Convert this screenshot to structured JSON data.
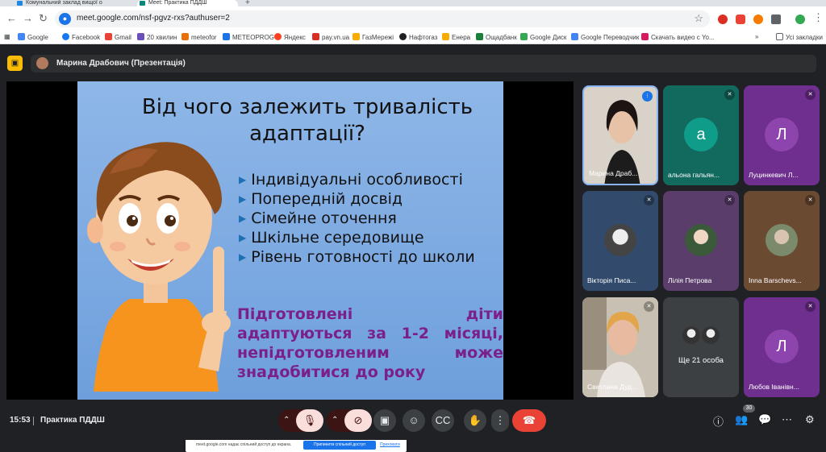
{
  "browser": {
    "tabs": [
      {
        "label": "Комунальний заклад вищої о"
      },
      {
        "label": "Meet: Практика ПДДШ"
      }
    ],
    "url": "meet.google.com/nsf-pgvz-rxs?authuser=2",
    "bookmarks": [
      {
        "label": "Google",
        "color": "#4285f4"
      },
      {
        "label": "Facebook",
        "color": "#1877f2"
      },
      {
        "label": "Gmail",
        "color": "#ea4335"
      },
      {
        "label": "20 хвилин",
        "color": "#6b4fbb"
      },
      {
        "label": "meteofor",
        "color": "#e8710a"
      },
      {
        "label": "METEOPROG",
        "color": "#1a73e8"
      },
      {
        "label": "Яндекс",
        "color": "#fc3f1d"
      },
      {
        "label": "pay.vn.ua",
        "color": "#d93025"
      },
      {
        "label": "ГазМережі",
        "color": "#f9ab00"
      },
      {
        "label": "Нафтогаз",
        "color": "#202124"
      },
      {
        "label": "Енера",
        "color": "#f9ab00"
      },
      {
        "label": "Ощадбанк",
        "color": "#188038"
      },
      {
        "label": "Google Диск",
        "color": "#34a853"
      },
      {
        "label": "Google Переводчик",
        "color": "#4285f4"
      },
      {
        "label": "Скачать видео с Yo...",
        "color": "#d81b60"
      }
    ],
    "all_bookmarks": "Усі закладки"
  },
  "meet": {
    "presenter_label": "Марина Драбович (Презентація)",
    "slide": {
      "title": "Від чого залежить тривалість адаптації?",
      "bullets": [
        "Індивідуальні особливості",
        "Попередній досвід",
        "Сімейне оточення",
        "Шкільне середовище",
        "Рівень готовності до школи"
      ],
      "note": "Підготовлені діти адаптуються за 1-2 місяці, непідготовленим може знадобитися до року"
    },
    "share_bar": {
      "message": "meet.google.com надає спільний доступ до екрана.",
      "stop_label": "Припинити спільний доступ",
      "hide_label": "Приховати"
    },
    "participants": [
      {
        "name": "Марина Драб...",
        "type": "video",
        "bg": "#c9c2b8"
      },
      {
        "name": "альона гальян...",
        "type": "letter",
        "letter": "а",
        "bg": "#12695e",
        "circle": "#0f9d8a"
      },
      {
        "name": "Луцинкевич Л...",
        "type": "letter",
        "letter": "Л",
        "bg": "#6f2f8e",
        "circle": "#8e44ad"
      },
      {
        "name": "Вікторія Писа...",
        "type": "photo",
        "bg": "#324a6b"
      },
      {
        "name": "Лілія Петрова",
        "type": "photo",
        "bg": "#5a3d6b"
      },
      {
        "name": "Inna Barschevs...",
        "type": "photo",
        "bg": "#6b4a32"
      },
      {
        "name": "Светлана Дуд...",
        "type": "video",
        "bg": "#b9b3a8"
      },
      {
        "name": "Ще 21 особа",
        "type": "more",
        "bg": "#3c4043"
      },
      {
        "name": "Любов Іванівн...",
        "type": "letter",
        "letter": "Л",
        "bg": "#6f2f8e",
        "circle": "#8e44ad"
      }
    ],
    "time": "15:53",
    "meeting_name": "Практика ПДДШ",
    "participant_count": "30"
  }
}
